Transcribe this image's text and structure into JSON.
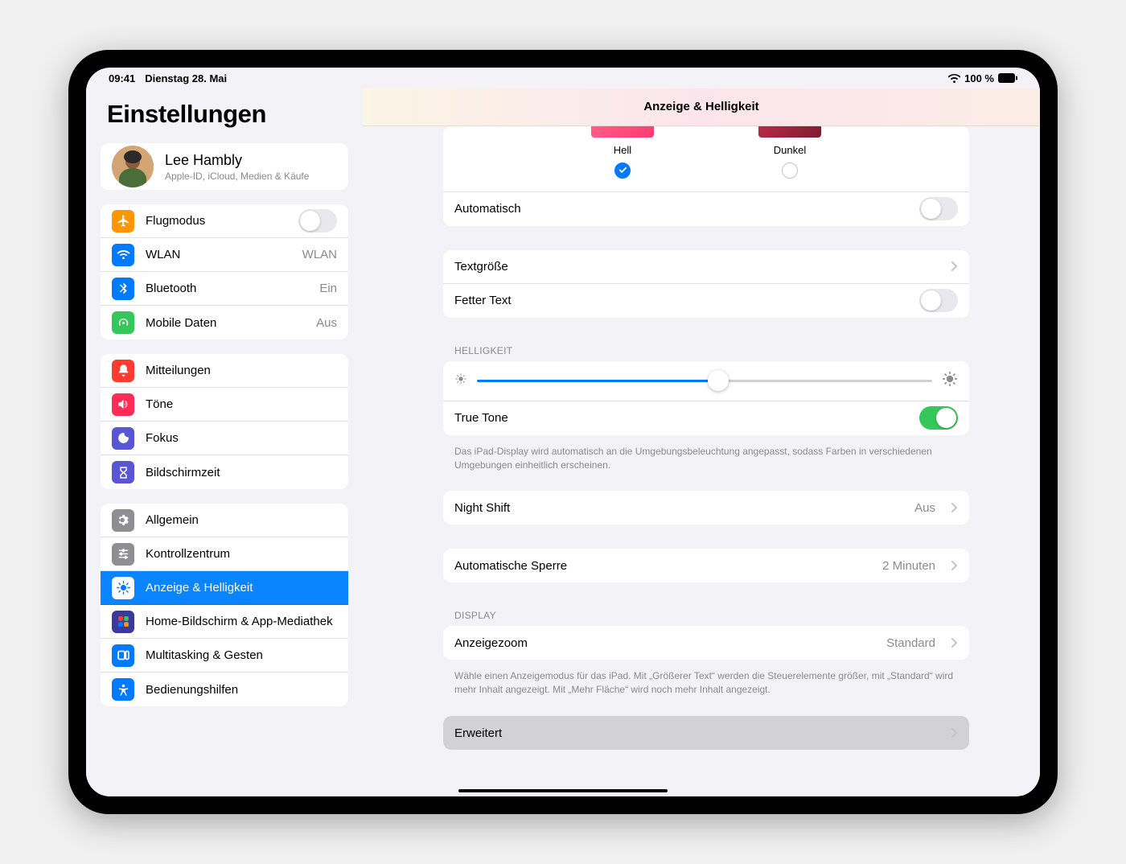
{
  "statusbar": {
    "time": "09:41",
    "date": "Dienstag 28. Mai",
    "battery": "100 %"
  },
  "sidebar": {
    "title": "Einstellungen",
    "profile": {
      "name": "Lee Hambly",
      "sub": "Apple-ID, iCloud, Medien & Käufe"
    },
    "g1": {
      "airplane": "Flugmodus",
      "wlan": "WLAN",
      "wlan_val": "WLAN",
      "bt": "Bluetooth",
      "bt_val": "Ein",
      "cell": "Mobile Daten",
      "cell_val": "Aus"
    },
    "g2": {
      "notif": "Mitteilungen",
      "sounds": "Töne",
      "focus": "Fokus",
      "screentime": "Bildschirmzeit"
    },
    "g3": {
      "general": "Allgemein",
      "control": "Kontrollzentrum",
      "display": "Anzeige & Helligkeit",
      "home": "Home-Bildschirm & App-Mediathek",
      "multi": "Multitasking & Gesten",
      "access": "Bedienungshilfen"
    }
  },
  "content": {
    "title": "Anzeige & Helligkeit",
    "appearance": {
      "light": "Hell",
      "dark": "Dunkel",
      "auto": "Automatisch"
    },
    "textsize": "Textgröße",
    "bold": "Fetter Text",
    "brightness_header": "HELLIGKEIT",
    "truetone": "True Tone",
    "truetone_footer": "Das iPad-Display wird automatisch an die Umgebungsbeleuchtung angepasst, sodass Farben in verschiedenen Umgebungen einheitlich erscheinen.",
    "nightshift": "Night Shift",
    "nightshift_val": "Aus",
    "autolock": "Automatische Sperre",
    "autolock_val": "2 Minuten",
    "display_header": "DISPLAY",
    "zoom": "Anzeigezoom",
    "zoom_val": "Standard",
    "zoom_footer": "Wähle einen Anzeigemodus für das iPad. Mit „Größerer Text“ werden die Steuerelemente größer, mit „Standard“ wird mehr Inhalt angezeigt. Mit „Mehr Fläche“ wird noch mehr Inhalt angezeigt.",
    "advanced": "Erweitert"
  }
}
